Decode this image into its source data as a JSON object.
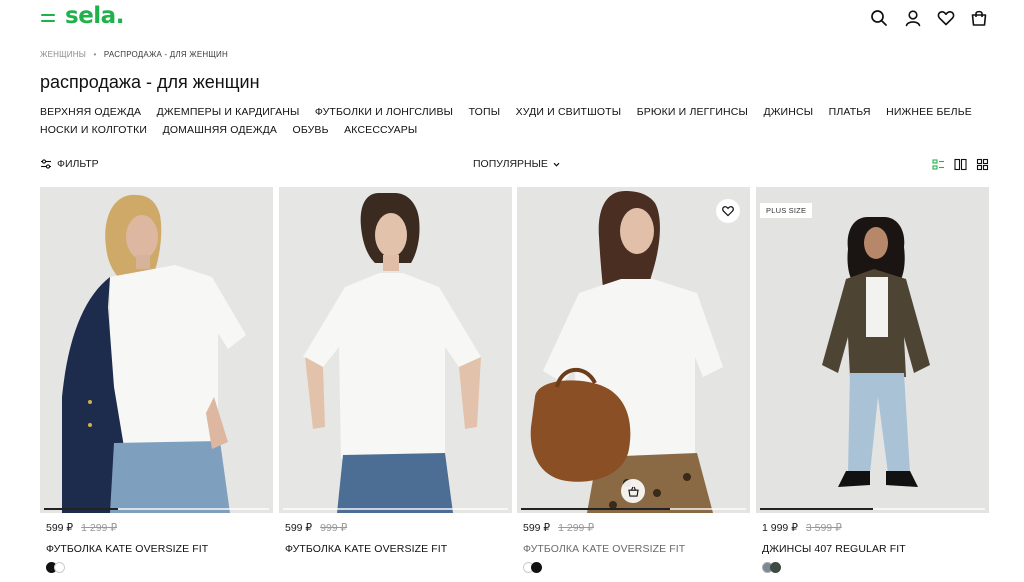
{
  "header": {
    "logo": "sela.",
    "brand_color": "#1fb24b",
    "icons": [
      "menu-icon",
      "search-icon",
      "account-icon",
      "heart-icon",
      "bag-icon"
    ]
  },
  "breadcrumb": {
    "parent": "ЖЕНЩИНЫ",
    "separator": "•",
    "current": "РАСПРОДАЖА - ДЛЯ ЖЕНЩИН"
  },
  "page_title": "распродажа - для женщин",
  "categories": {
    "row1": [
      "ВЕРХНЯЯ ОДЕЖДА",
      "ДЖЕМПЕРЫ И КАРДИГАНЫ",
      "ФУТБОЛКИ И ЛОНГСЛИВЫ",
      "ТОПЫ",
      "ХУДИ И СВИТШОТЫ",
      "БРЮКИ И ЛЕГГИНСЫ",
      "ДЖИНСЫ",
      "ПЛАТЬЯ",
      "НИЖНЕЕ БЕЛЬЕ"
    ],
    "row2": [
      "НОСКИ И КОЛГОТКИ",
      "ДОМАШНЯЯ ОДЕЖДА",
      "ОБУВЬ",
      "АКСЕССУАРЫ"
    ]
  },
  "toolbar": {
    "filter_label": "ФИЛЬТР",
    "sort_label": "ПОПУЛЯРНЫЕ",
    "active_view_color": "#1fb24b"
  },
  "products": [
    {
      "price": "599 ₽",
      "old_price": "1 299 ₽",
      "name": "ФУТБОЛКА KATE OVERSIZE FIT",
      "swatches": [
        "#111111",
        "#ffffff"
      ],
      "gallery_progress": 0.33
    },
    {
      "price": "599 ₽",
      "old_price": "999 ₽",
      "name": "ФУТБОЛКА KATE OVERSIZE FIT",
      "swatches": [],
      "gallery_progress": 0
    },
    {
      "price": "599 ₽",
      "old_price": "1 299 ₽",
      "name": "ФУТБОЛКА KATE OVERSIZE FIT",
      "swatches": [
        "#ffffff",
        "#111111"
      ],
      "gallery_progress": 0.66
    },
    {
      "price": "1 999 ₽",
      "old_price": "3 599 ₽",
      "name": "ДЖИНСЫ 407 REGULAR FIT",
      "badge": "PLUS SIZE",
      "swatches": [
        "#7a8a95",
        "#3e4a44"
      ],
      "gallery_progress": 0.5
    }
  ]
}
